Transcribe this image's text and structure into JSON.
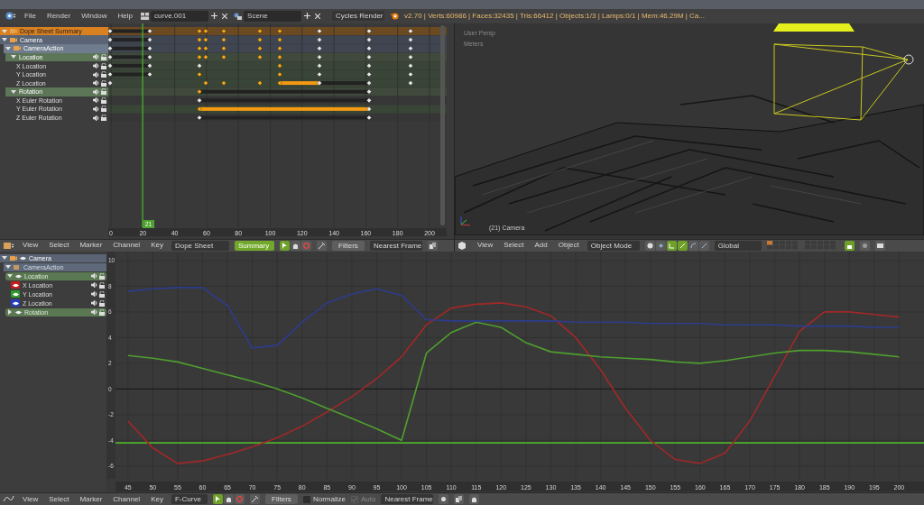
{
  "info_header": {
    "menus": [
      "File",
      "Render",
      "Window",
      "Help"
    ],
    "screen": "curve.001",
    "scene": "Scene",
    "engine": "Cycles Render",
    "stats": "v2.70 | Verts:60986 | Faces:32435 | Tris:66412 | Objects:1/3 | Lamps:0/1 | Mem:46.29M | Ca..."
  },
  "dope_sheet": {
    "channels": [
      {
        "kind": "summary",
        "label": "Dope Sheet Summary",
        "expanded": true
      },
      {
        "kind": "object",
        "label": "Camera",
        "expanded": true,
        "children": [
          {
            "kind": "action",
            "label": "CameraAction",
            "expanded": true,
            "children": [
              {
                "kind": "group",
                "label": "Location",
                "expanded": true,
                "children": [
                  {
                    "kind": "channel",
                    "label": "X Location"
                  },
                  {
                    "kind": "channel",
                    "label": "Y Location"
                  },
                  {
                    "kind": "channel",
                    "label": "Z Location"
                  }
                ]
              },
              {
                "kind": "group",
                "label": "Rotation",
                "expanded": true,
                "children": [
                  {
                    "kind": "channel",
                    "label": "X Euler Rotation"
                  },
                  {
                    "kind": "channel",
                    "label": "Y Euler Rotation"
                  },
                  {
                    "kind": "channel",
                    "label": "Z Euler Rotation"
                  }
                ]
              }
            ]
          }
        ]
      }
    ],
    "ruler": [
      "0",
      "20",
      "40",
      "60",
      "80",
      "100",
      "120",
      "140",
      "160",
      "180",
      "200"
    ],
    "current_frame": "21",
    "header": {
      "menus": [
        "View",
        "Select",
        "Marker",
        "Channel",
        "Key"
      ],
      "mode": "Dope Sheet",
      "summary": {
        "label": "Summary",
        "on": true
      },
      "filters": "Filters",
      "snap": "Nearest Frame"
    }
  },
  "viewport": {
    "view_name": "User Persp",
    "units": "Meters",
    "object_label": "(21) Camera",
    "header": {
      "menus": [
        "View",
        "Select",
        "Add",
        "Object"
      ],
      "mode": "Object Mode",
      "orientation": "Global"
    }
  },
  "graph_editor": {
    "channels": [
      {
        "kind": "object",
        "label": "Camera",
        "expanded": true,
        "children": [
          {
            "kind": "action",
            "label": "CameraAction",
            "expanded": true,
            "children": [
              {
                "kind": "group",
                "label": "Location",
                "expanded": true,
                "children": [
                  {
                    "kind": "channel",
                    "label": "X Location",
                    "color": "#c41e1e"
                  },
                  {
                    "kind": "channel",
                    "label": "Y Location",
                    "color": "#2e9a2e"
                  },
                  {
                    "kind": "channel",
                    "label": "Z Location",
                    "color": "#2440c0"
                  }
                ]
              },
              {
                "kind": "group",
                "label": "Rotation",
                "expanded": false
              }
            ]
          }
        ]
      }
    ],
    "chart_data": {
      "type": "line",
      "x": [
        45,
        50,
        55,
        60,
        65,
        70,
        75,
        80,
        85,
        90,
        95,
        100,
        105,
        110,
        115,
        120,
        125,
        130,
        135,
        140,
        145,
        150,
        155,
        160,
        165,
        170,
        175,
        180,
        185,
        190,
        195,
        200
      ],
      "series": [
        {
          "color": "#a02828",
          "values": [
            -2.5,
            -4.6,
            -5.8,
            -5.6,
            -5.1,
            -4.5,
            -3.8,
            -2.9,
            -1.8,
            -0.6,
            0.8,
            2.5,
            5.0,
            6.3,
            6.6,
            6.7,
            6.4,
            5.7,
            4.0,
            1.5,
            -1.5,
            -4.0,
            -5.5,
            -5.8,
            -5.0,
            -2.5,
            1.0,
            4.5,
            6.0,
            6.0,
            5.8,
            5.6
          ]
        },
        {
          "color": "#4f9f2f",
          "values": [
            2.6,
            2.4,
            2.1,
            1.6,
            1.1,
            0.6,
            0.0,
            -0.7,
            -1.5,
            -2.3,
            -3.1,
            -4.0,
            2.8,
            4.4,
            5.2,
            4.8,
            3.6,
            2.9,
            2.7,
            2.5,
            2.4,
            2.3,
            2.1,
            2.0,
            2.2,
            2.5,
            2.8,
            3.0,
            3.0,
            2.9,
            2.7,
            2.5
          ]
        },
        {
          "color": "#2d3c8c",
          "values": [
            7.6,
            7.8,
            7.9,
            7.9,
            6.5,
            3.2,
            3.4,
            5.2,
            6.7,
            7.4,
            7.8,
            7.3,
            5.4,
            5.3,
            5.3,
            5.3,
            5.3,
            5.3,
            5.2,
            5.2,
            5.2,
            5.1,
            5.1,
            5.1,
            5.0,
            5.0,
            5.0,
            4.9,
            4.9,
            4.9,
            4.8,
            4.8
          ]
        }
      ],
      "xlim": [
        42.5,
        205
      ],
      "ylim": [
        -7,
        10.7
      ],
      "xticks": [
        45,
        50,
        55,
        60,
        65,
        70,
        75,
        80,
        85,
        90,
        95,
        100,
        105,
        110,
        115,
        120,
        125,
        130,
        135,
        140,
        145,
        150,
        155,
        160,
        165,
        170,
        175,
        180,
        185,
        190,
        195,
        200
      ],
      "yticks": [
        -6,
        -4,
        -2,
        0,
        2,
        4,
        6,
        8,
        10
      ],
      "grid": true,
      "ref_lines": [
        {
          "axis": "y",
          "value": -4.2,
          "color": "#4caf2a"
        }
      ]
    },
    "header": {
      "menus": [
        "View",
        "Select",
        "Marker",
        "Channel",
        "Key"
      ],
      "mode": "F-Curve",
      "filters": "Filters",
      "normalize": {
        "label": "Normalize",
        "checked": false
      },
      "auto": {
        "label": "Auto",
        "checked": true,
        "disabled": true
      },
      "snap": "Nearest Frame"
    }
  }
}
